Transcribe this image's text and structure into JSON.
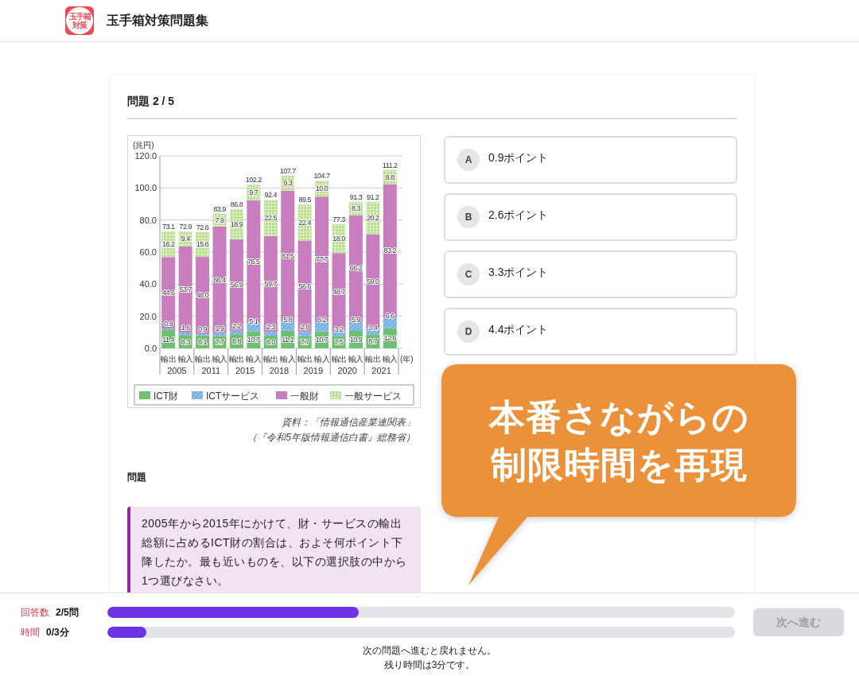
{
  "header": {
    "logo": {
      "line_1": "玉手箱",
      "line_2": "対策"
    },
    "title": "玉手箱対策問題集"
  },
  "card": {
    "title": "問題 2 / 5",
    "figure": {
      "chart_data": {
        "type": "bar",
        "stacked": true,
        "grid": true,
        "legend": true,
        "ylabel": "(兆円)",
        "xlabel": "(年)",
        "ylim": [
          0,
          120
        ],
        "yticks": [
          {
            "value": 0,
            "label": "0.0"
          },
          {
            "value": 20,
            "label": "20.0"
          },
          {
            "value": 40,
            "label": "40.0"
          },
          {
            "value": 60,
            "label": "60.0"
          },
          {
            "value": 80,
            "label": "80.0"
          },
          {
            "value": 100,
            "label": "100.0"
          },
          {
            "value": 120,
            "label": "120.0"
          }
        ],
        "categories": [
          "輸出",
          "輸入",
          "輸出",
          "輸入",
          "輸出",
          "輸入",
          "輸出",
          "輸入",
          "輸出",
          "輸入",
          "輸出",
          "輸入",
          "輸出",
          "輸入"
        ],
        "series": [
          {
            "name": "ICT財",
            "color": "#6cc070",
            "values": [
              11.4,
              8.3,
              8.1,
              7.7,
              8.8,
              10.7,
              8.0,
              11.1,
              7.7,
              10.7,
              7.5,
              10.9,
              8.7,
              12.6
            ],
            "value_labels": [
              "11.4",
              "8.3",
              "8.1",
              "7.7",
              "8.8",
              "10.7",
              "8.0",
              "11.1",
              "7.7",
              "10.7",
              "7.5",
              "10.9",
              "8.7",
              "12.6"
            ]
          },
          {
            "name": "ICTサービス",
            "color": "#8cc0ea",
            "values": [
              0.9,
              1.6,
              0.9,
              1.9,
              2.2,
              5.1,
              2.3,
              5.8,
              2.9,
              6.2,
              3.2,
              5.9,
              3.4,
              6.6
            ],
            "value_labels": [
              "0.9",
              "1.6",
              "0.9",
              "1.9",
              "2.2",
              "5.1",
              "2.3",
              "5.8",
              "2.9",
              "6.2",
              "3.2",
              "5.9",
              "3.4",
              "6.6"
            ]
          },
          {
            "name": "一般財",
            "color": "#c77dbe",
            "values": [
              44.6,
              53.7,
              48.0,
              66.4,
              56.9,
              76.5,
              59.7,
              81.5,
              56.6,
              77.7,
              48.7,
              66.2,
              59.0,
              83.2
            ],
            "value_labels": [
              "44.6",
              "53.7",
              "48.0",
              "66.4",
              "56.9",
              "76.5",
              "59.7",
              "81.5",
              "56.6",
              "77.7",
              "48.7",
              "66.2",
              "59.0",
              "83.2"
            ]
          },
          {
            "name": "一般サービス",
            "color": "#b9de8e",
            "values": [
              16.2,
              9.4,
              15.6,
              7.9,
              18.9,
              9.7,
              22.5,
              9.3,
              22.4,
              10.0,
              18.0,
              8.3,
              20.2,
              8.8
            ],
            "value_labels": [
              "16.2",
              "9.4",
              "15.6",
              "7.9",
              "18.9",
              "9.7",
              "22.5",
              "9.3",
              "22.4",
              "10.0",
              "18.0",
              "8.3",
              "20.2",
              "8.8"
            ]
          }
        ]
      },
      "bar_totals": [
        "73.1",
        "72.9",
        "72.6",
        "83.9",
        "86.8",
        "102.2",
        "92.4",
        "107.7",
        "89.5",
        "104.7",
        "77.3",
        "91.3",
        "91.2",
        "111.2"
      ],
      "year_labels": [
        "2005",
        "2011",
        "2015",
        "2018",
        "2019",
        "2020",
        "2021"
      ],
      "source_lines": [
        "資料：「情報通信産業連関表」",
        "（『令和5年版情報通信白書』総務省）"
      ]
    },
    "question_label": "問題",
    "question": "2005年から2015年にかけて、財・サービスの輸出総額に占めるICT財の割合は、およそ何ポイント下降したか。最も近いものを、以下の選択肢の中から1つ選びなさい。",
    "options": [
      {
        "letter": "A",
        "text": "0.9ポイント",
        "selected": false
      },
      {
        "letter": "B",
        "text": "2.6ポイント",
        "selected": false
      },
      {
        "letter": "C",
        "text": "3.3ポイント",
        "selected": false
      },
      {
        "letter": "D",
        "text": "4.4ポイント",
        "selected": false
      }
    ]
  },
  "callout": {
    "lines": [
      "本番さながらの",
      "制限時間を再現"
    ]
  },
  "footer": {
    "progress": [
      {
        "label": "回答数",
        "value": "2/5問",
        "level": 0.4
      },
      {
        "label": "時間",
        "value": "0/3分",
        "level": 0.062
      }
    ],
    "next_button": {
      "label": "次へ進む",
      "disabled": true
    },
    "notes": [
      "次の問題へ進むと戻れません。",
      "残り時間は3分です。"
    ]
  }
}
